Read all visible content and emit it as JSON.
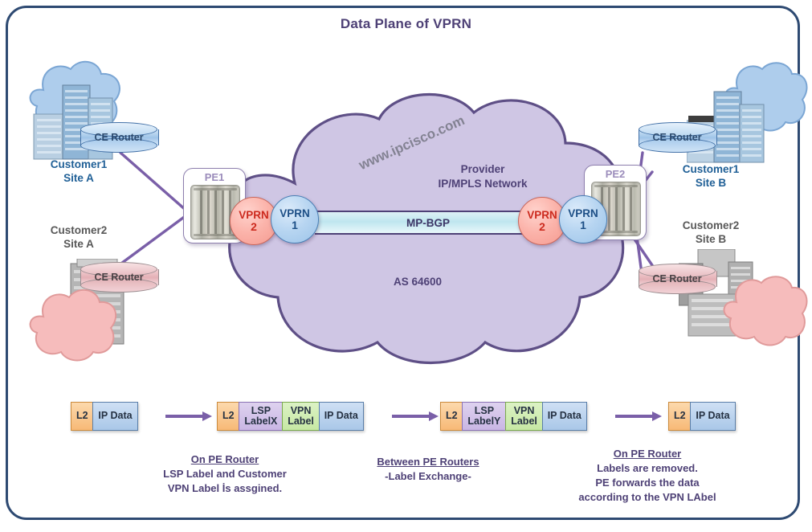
{
  "title": "Data Plane of VPRN",
  "watermark": "www.ipcisco.com",
  "colors": {
    "frame_border": "#2e4a72",
    "title_purple": "#4e4176",
    "provider_cloud_fill": "#cfc6e4",
    "provider_cloud_stroke": "#5e4f86",
    "customer1_cloud": "#aecdec",
    "customer2_cloud": "#f6bcbc",
    "vprn2_red": "#cc2a1e",
    "vprn1_blue": "#1d4f86",
    "mpbgp_pipe": "#bfe6ef",
    "link_purple": "#7a5fa8"
  },
  "provider": {
    "label_line1": "Provider",
    "label_line2": "IP/MPLS Network",
    "as_label": "AS 64600",
    "mpbgp_label": "MP-BGP"
  },
  "pe_routers": [
    {
      "name": "pe1",
      "tag": "PE1",
      "vprn2": {
        "label": "VPRN",
        "number": "2"
      },
      "vprn1": {
        "label": "VPRN",
        "number": "1"
      }
    },
    {
      "name": "pe2",
      "tag": "PE2",
      "vprn2": {
        "label": "VPRN",
        "number": "2"
      },
      "vprn1": {
        "label": "VPRN",
        "number": "1"
      }
    }
  ],
  "sites": [
    {
      "id": "c1a",
      "ce_label": "CE Router",
      "name_line1": "Customer1",
      "name_line2": "Site A",
      "color": "blue"
    },
    {
      "id": "c2a",
      "ce_label": "CE Router",
      "name_line1": "Customer2",
      "name_line2": "Site A",
      "color": "gray"
    },
    {
      "id": "c1b",
      "ce_label": "CE Router",
      "name_line1": "Customer1",
      "name_line2": "Site B",
      "color": "blue"
    },
    {
      "id": "c2b",
      "ce_label": "CE Router",
      "name_line1": "Customer2",
      "name_line2": "Site B",
      "color": "gray"
    }
  ],
  "packets": [
    {
      "id": "p1",
      "segments": [
        {
          "text": "L2",
          "style": "orange"
        },
        {
          "text": "IP Data",
          "style": "blue"
        }
      ]
    },
    {
      "id": "p2",
      "segments": [
        {
          "text": "L2",
          "style": "orange"
        },
        {
          "line1": "LSP",
          "line2": "LabelX",
          "style": "purple"
        },
        {
          "line1": "VPN",
          "line2": "Label",
          "style": "green"
        },
        {
          "text": "IP Data",
          "style": "blue"
        }
      ]
    },
    {
      "id": "p3",
      "segments": [
        {
          "text": "L2",
          "style": "orange"
        },
        {
          "line1": "LSP",
          "line2": "LabelY",
          "style": "purple"
        },
        {
          "line1": "VPN",
          "line2": "Label",
          "style": "green"
        },
        {
          "text": "IP Data",
          "style": "blue"
        }
      ]
    },
    {
      "id": "p4",
      "segments": [
        {
          "text": "L2",
          "style": "orange"
        },
        {
          "text": "IP Data",
          "style": "blue"
        }
      ]
    }
  ],
  "captions": [
    {
      "id": "cap1",
      "heading": "On PE Router",
      "line1": "LSP Label and Customer",
      "line2": "VPN Label İs assgined.",
      "line3": ""
    },
    {
      "id": "cap2",
      "heading": "Between PE Routers",
      "line1": "-Label Exchange-",
      "line2": "",
      "line3": ""
    },
    {
      "id": "cap3",
      "heading": "On PE Router ",
      "line1": "Labels are removed.",
      "line2": "PE forwards the data",
      "line3": "according to the VPN LAbel"
    }
  ]
}
